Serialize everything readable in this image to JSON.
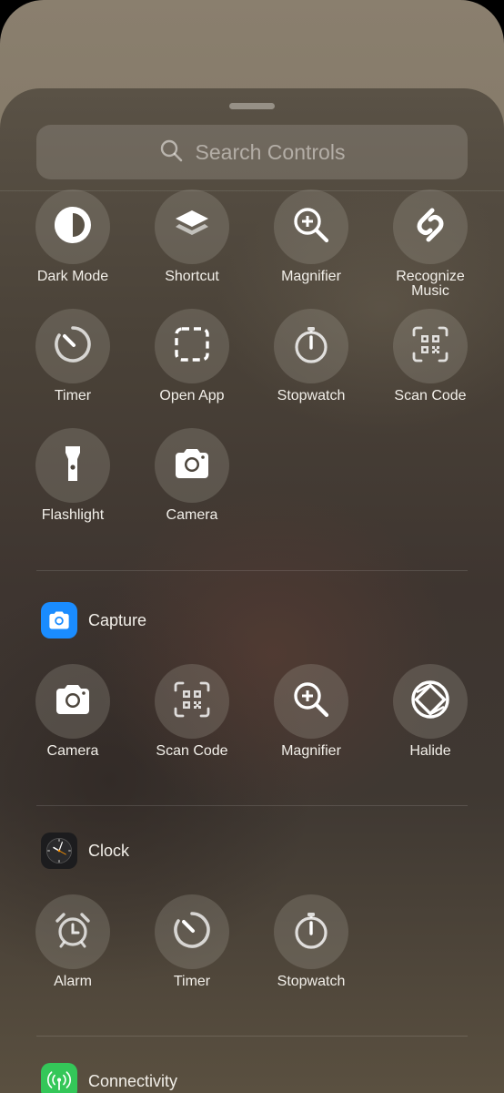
{
  "search": {
    "placeholder": "Search Controls"
  },
  "suggested": [
    {
      "label": "Dark Mode",
      "icon": "dark-mode-icon"
    },
    {
      "label": "Shortcut",
      "icon": "shortcuts-layers-icon"
    },
    {
      "label": "Magnifier",
      "icon": "magnifier-icon"
    },
    {
      "label": "Recognize\nMusic",
      "icon": "shazam-icon"
    },
    {
      "label": "Timer",
      "icon": "timer-icon"
    },
    {
      "label": "Open App",
      "icon": "open-app-dashed-square-icon"
    },
    {
      "label": "Stopwatch",
      "icon": "stopwatch-icon"
    },
    {
      "label": "Scan Code",
      "icon": "qr-code-icon"
    },
    {
      "label": "Flashlight",
      "icon": "flashlight-icon"
    },
    {
      "label": "Camera",
      "icon": "camera-icon"
    }
  ],
  "sections": [
    {
      "title": "Capture",
      "app_icon": "camera-app-icon",
      "app_color": "#1a8cff",
      "items": [
        {
          "label": "Camera",
          "icon": "camera-icon"
        },
        {
          "label": "Scan Code",
          "icon": "qr-code-icon"
        },
        {
          "label": "Magnifier",
          "icon": "magnifier-icon"
        },
        {
          "label": "Halide",
          "icon": "halide-aperture-icon"
        }
      ]
    },
    {
      "title": "Clock",
      "app_icon": "clock-app-icon",
      "app_color": "#1c1c1e",
      "items": [
        {
          "label": "Alarm",
          "icon": "alarm-icon"
        },
        {
          "label": "Timer",
          "icon": "timer-icon"
        },
        {
          "label": "Stopwatch",
          "icon": "stopwatch-icon"
        }
      ]
    },
    {
      "title": "Connectivity",
      "app_icon": "connectivity-app-icon",
      "app_color": "#34c759",
      "items": []
    }
  ]
}
